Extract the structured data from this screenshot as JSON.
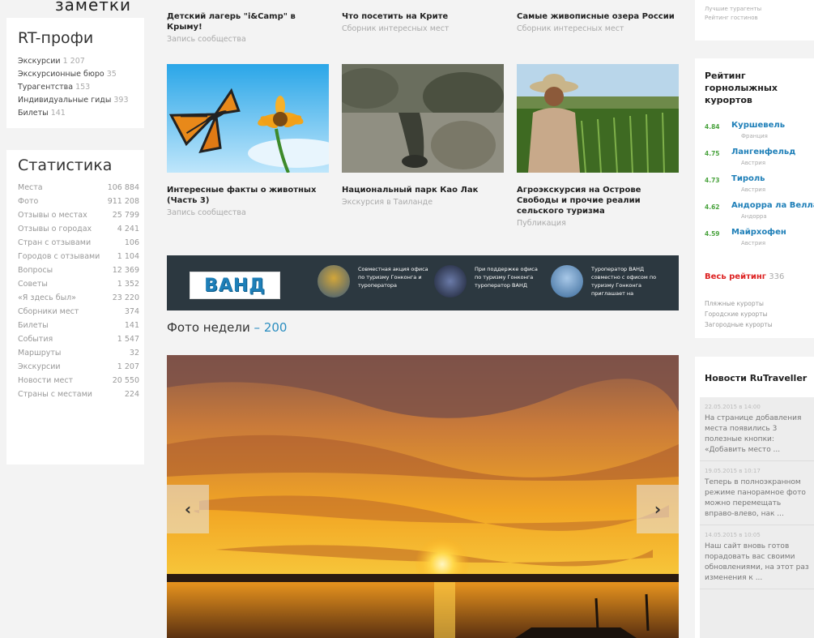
{
  "top_cut_text": "заметки",
  "rtprofi": {
    "title": "RT-профи",
    "items": [
      {
        "label": "Экскурсии",
        "count": "1 207"
      },
      {
        "label": "Экскурсионные бюро",
        "count": "35"
      },
      {
        "label": "Турагентства",
        "count": "153"
      },
      {
        "label": "Индивидуальные гиды",
        "count": "393"
      },
      {
        "label": "Билеты",
        "count": "141"
      }
    ]
  },
  "stats": {
    "title": "Статистика",
    "rows": [
      {
        "label": "Места",
        "value": "106 884"
      },
      {
        "label": "Фото",
        "value": "911 208"
      },
      {
        "label": "Отзывы о местах",
        "value": "25 799"
      },
      {
        "label": "Отзывы о городах",
        "value": "4 241"
      },
      {
        "label": "Стран с отзывами",
        "value": "106"
      },
      {
        "label": "Городов с отзывами",
        "value": "1 104"
      },
      {
        "label": "Вопросы",
        "value": "12 369"
      },
      {
        "label": "Советы",
        "value": "1 352"
      },
      {
        "label": "«Я здесь был»",
        "value": "23 220"
      },
      {
        "label": "Сборники мест",
        "value": "374"
      },
      {
        "label": "Билеты",
        "value": "141"
      },
      {
        "label": "События",
        "value": "1 547"
      },
      {
        "label": "Маршруты",
        "value": "32"
      },
      {
        "label": "Экскурсии",
        "value": "1 207"
      },
      {
        "label": "Новости мест",
        "value": "20 550"
      },
      {
        "label": "Страны с местами",
        "value": "224"
      }
    ]
  },
  "articles_top": [
    {
      "title": "Детский лагерь \"i&Camp\" в Крыму!",
      "sub": "Запись сообщества"
    },
    {
      "title": "Что посетить на Крите",
      "sub": "Сборник интересных мест"
    },
    {
      "title": "Самые живописные озера России",
      "sub": "Сборник интересных мест"
    }
  ],
  "articles_bottom": [
    {
      "title": "Интересные факты о животных (Часть 3)",
      "sub": "Запись сообщества"
    },
    {
      "title": "Национальный парк Као Лак",
      "sub": "Экскурсия в Таиланде"
    },
    {
      "title": "Агроэкскурсия на Острове Свободы и прочие реалии сельского туризма",
      "sub": "Публикация"
    }
  ],
  "banner": {
    "logo": "ВАНД",
    "items": [
      {
        "text": "Совместная акция офиса по туризму Гонконга и туроператора"
      },
      {
        "text": "При поддержке офиса по туризму Гонконга туроператор ВАНД"
      },
      {
        "text": "Туроператор ВАНД совместно с офисом по туризму Гонконга приглашает на"
      }
    ]
  },
  "photo_week": {
    "title": "Фото недели",
    "dash": "–",
    "number": "200"
  },
  "slider": {
    "prev": "‹",
    "next": "›"
  },
  "right_top": {
    "line1": "Лучшие турагенты",
    "line2": "Рейтинг гостинов"
  },
  "rating": {
    "title": "Рейтинг горнолыжных курортов",
    "items": [
      {
        "score": "4.84",
        "name": "Куршевель",
        "country": "Франция"
      },
      {
        "score": "4.75",
        "name": "Лангенфельд",
        "country": "Австрия"
      },
      {
        "score": "4.73",
        "name": "Тироль",
        "country": "Австрия"
      },
      {
        "score": "4.62",
        "name": "Андорра ла Велла",
        "country": "Андорра"
      },
      {
        "score": "4.59",
        "name": "Майрхофен",
        "country": "Австрия"
      }
    ],
    "all_label": "Весь рейтинг",
    "all_count": "336",
    "links": [
      "Пляжные курорты",
      "Городские курорты",
      "Загородные курорты"
    ]
  },
  "news": {
    "title": "Новости RuTraveller",
    "items": [
      {
        "date": "22.05.2015 в 14:00",
        "text": "На странице добавления места появились 3 полезные кнопки: «Добавить место ..."
      },
      {
        "date": "19.05.2015 в 10:17",
        "text": "Теперь в полноэкранном режиме панорамное фото можно перемещать вправо-влево, нак ..."
      },
      {
        "date": "14.05.2015 в 10:05",
        "text": "Наш сайт вновь готов порадовать вас своими обновлениями, на этот раз изменения к ..."
      }
    ]
  },
  "colors": {
    "accent": "#2b8ec0",
    "rating_score": "#4aa33e",
    "rating_name": "#1e7fb8",
    "all_rating": "#dd2222",
    "banner_bg": "#2c3840"
  }
}
